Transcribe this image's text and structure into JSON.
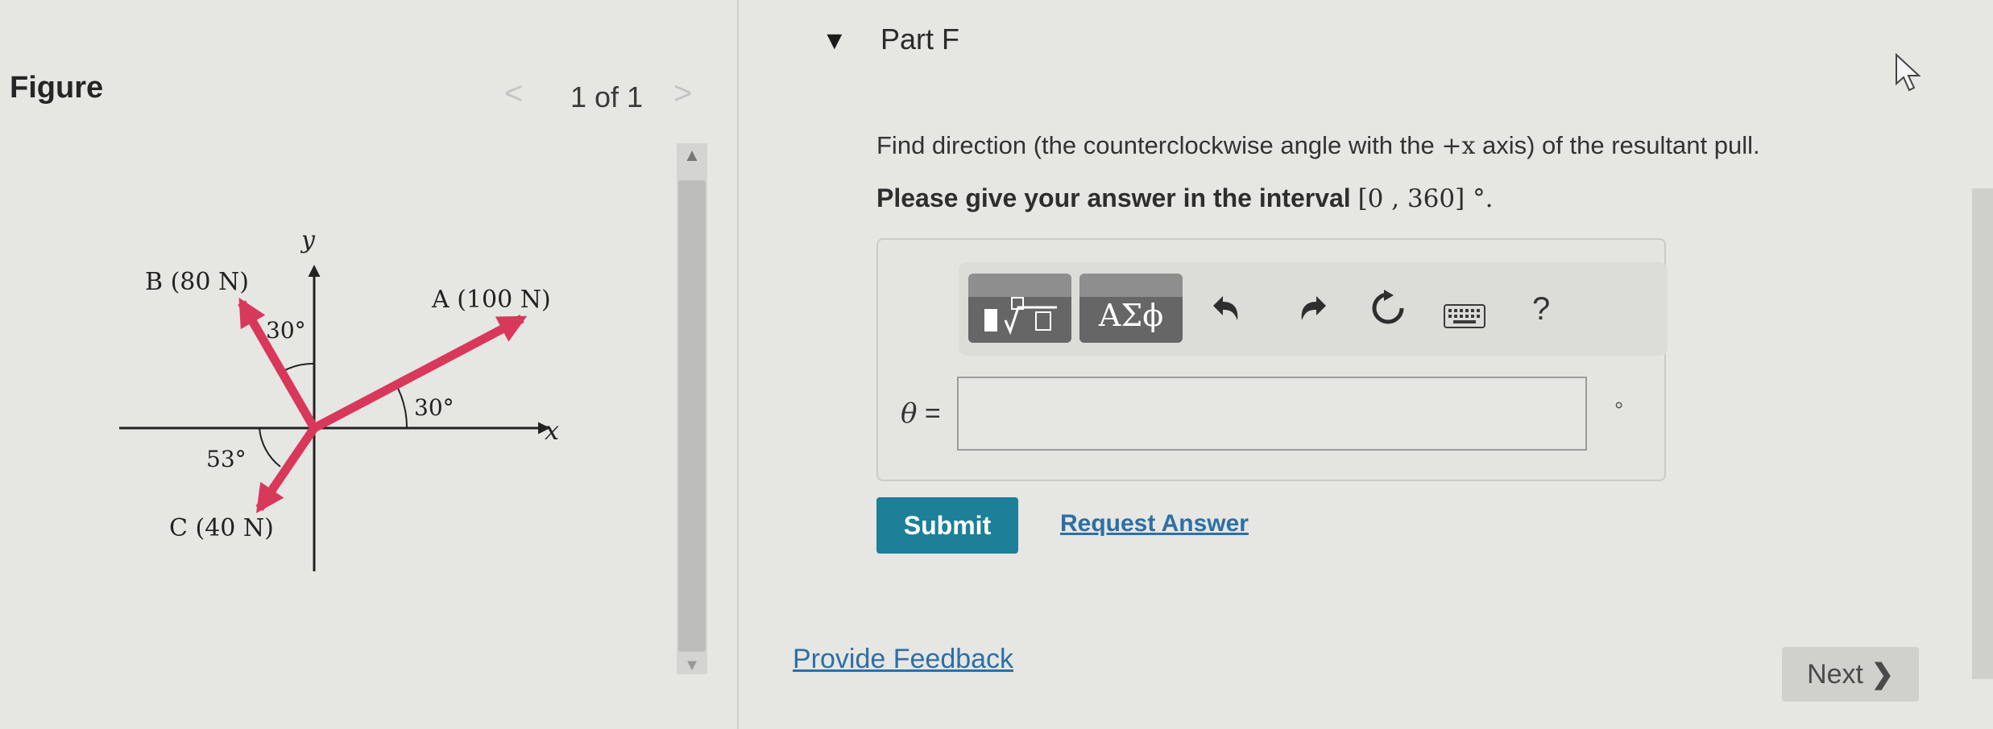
{
  "figure_panel": {
    "title": "Figure",
    "pager": {
      "prev": "<",
      "label": "1 of 1",
      "next": ">"
    },
    "diagram": {
      "y_axis_label": "y",
      "x_axis_label": "x",
      "vector_A_label": "A (100 N)",
      "vector_B_label": "B (80 N)",
      "vector_C_label": "C (40 N)",
      "angle_A": "30°",
      "angle_B": "30°",
      "angle_C": "53°",
      "vector_color": "#d8385a"
    }
  },
  "part": {
    "collapse_caret": "▼",
    "title": "Part F",
    "prompt_before": "Find direction (the counterclockwise angle with the ",
    "prompt_math": "+x",
    "prompt_after": " axis) of the resultant pull.",
    "interval_text": "Please give your answer in the interval ",
    "interval_math": "[0 , 360] °.",
    "toolbar": {
      "templates_icon": "fraction-sqrt-template-icon",
      "symbols_label": "ΑΣϕ",
      "undo_icon": "undo-icon",
      "redo_icon": "redo-icon",
      "reset_icon": "reset-icon",
      "keyboard_icon": "keyboard-icon",
      "help_label": "?"
    },
    "answer": {
      "variable": "θ",
      "equals": " =",
      "value": "",
      "unit": "°"
    },
    "submit_label": "Submit",
    "request_answer_label": "Request Answer"
  },
  "footer": {
    "feedback_label": "Provide Feedback",
    "next_label": "Next",
    "next_chevron": "❯"
  },
  "colors": {
    "accent": "#1d7f98",
    "link": "#2d6fa5",
    "vector": "#d8385a"
  }
}
